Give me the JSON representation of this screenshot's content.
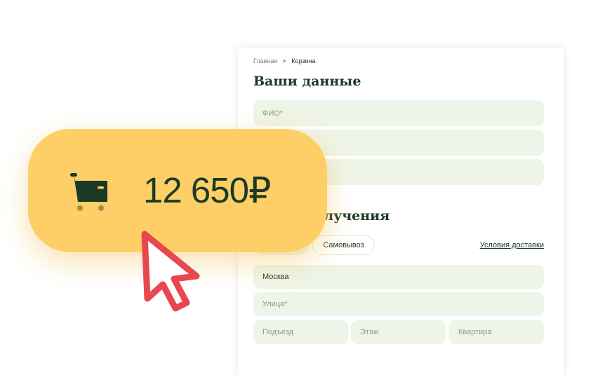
{
  "breadcrumb": {
    "home": "Главная",
    "current": "Корзина"
  },
  "personal": {
    "title": "Ваши данные",
    "fields": [
      {
        "placeholder": "ФИО*",
        "value": ""
      },
      {
        "placeholder": "",
        "value": ""
      },
      {
        "placeholder": "",
        "value": ""
      }
    ]
  },
  "delivery": {
    "title_visible": "олучения",
    "tabs": [
      {
        "label": "",
        "active": true
      },
      {
        "label": "Самовывоз",
        "active": false
      }
    ],
    "conditions_link": "Условия доставки",
    "city": "Москва",
    "street_placeholder": "Улица*",
    "entrance_placeholder": "Подъезд",
    "floor_placeholder": "Этаж",
    "apartment_placeholder": "Квартира"
  },
  "cart_total": {
    "amount": "12 650₽",
    "icon": "cart-icon"
  },
  "colors": {
    "accent_yellow": "#fdcf66",
    "dark_green": "#1b3a26",
    "field_bg": "#eef4e7",
    "cursor_red": "#e8474d"
  }
}
